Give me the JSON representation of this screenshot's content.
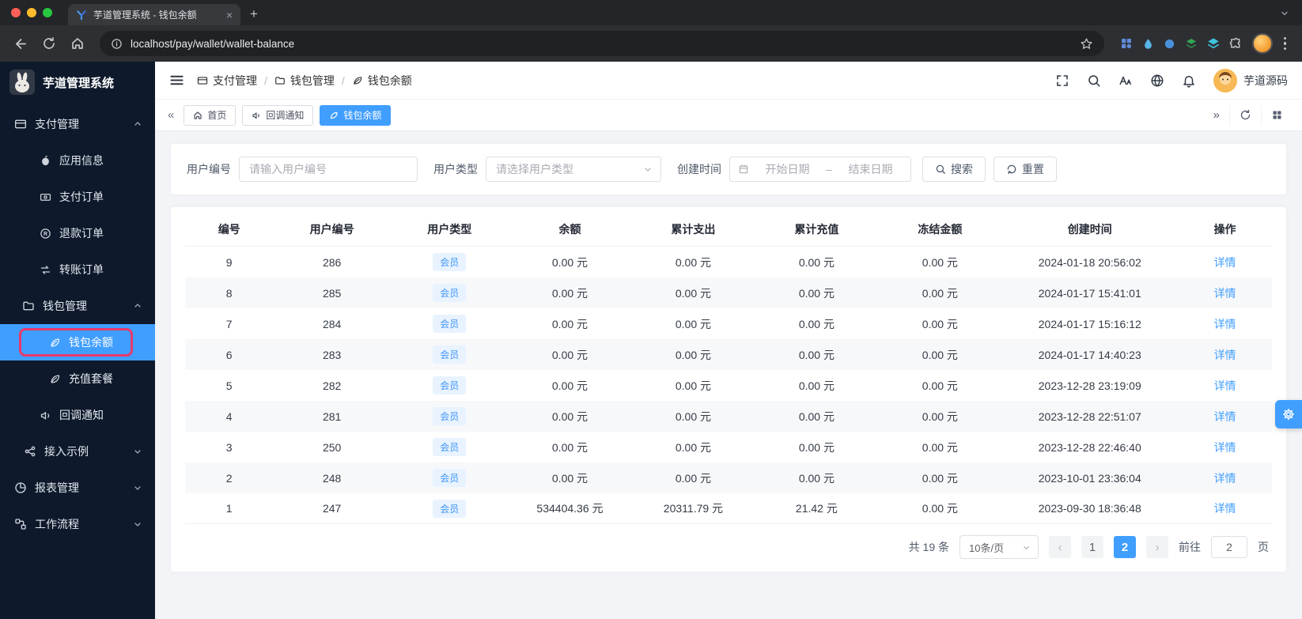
{
  "browser": {
    "tab_title": "芋道管理系统 - 钱包余额",
    "url": "localhost/pay/wallet/wallet-balance"
  },
  "glyphs": {
    "close_tab": "×",
    "new_tab": "+",
    "collapse_left": "«",
    "expand_right": "»",
    "page_prev": "‹",
    "page_next": "›"
  },
  "sidebar": {
    "app_title": "芋道管理系统",
    "menu": [
      {
        "label": "支付管理"
      },
      {
        "label": "应用信息"
      },
      {
        "label": "支付订单"
      },
      {
        "label": "退款订单"
      },
      {
        "label": "转账订单"
      },
      {
        "label": "钱包管理"
      },
      {
        "label": "钱包余额"
      },
      {
        "label": "充值套餐"
      },
      {
        "label": "回调通知"
      },
      {
        "label": "接入示例"
      },
      {
        "label": "报表管理"
      },
      {
        "label": "工作流程"
      }
    ]
  },
  "header": {
    "breadcrumb": {
      "sep": "/",
      "items": [
        {
          "label": "支付管理"
        },
        {
          "label": "钱包管理"
        },
        {
          "label": "钱包余额"
        }
      ]
    },
    "username": "芋道源码"
  },
  "tabs": [
    {
      "label": "首页"
    },
    {
      "label": "回调通知"
    },
    {
      "label": "钱包余额"
    }
  ],
  "filter": {
    "user_id_label": "用户编号",
    "user_id_placeholder": "请输入用户编号",
    "user_type_label": "用户类型",
    "user_type_placeholder": "请选择用户类型",
    "create_time_label": "创建时间",
    "date_start": "开始日期",
    "date_separator": "–",
    "date_end": "结束日期",
    "search": "搜索",
    "reset": "重置"
  },
  "table": {
    "columns": [
      "编号",
      "用户编号",
      "用户类型",
      "余额",
      "累计支出",
      "累计充值",
      "冻结金额",
      "创建时间",
      "操作"
    ],
    "rows": [
      {
        "id": "9",
        "user_id": "286",
        "user_type": "会员",
        "balance": "0.00 元",
        "expense": "0.00 元",
        "recharge": "0.00 元",
        "frozen": "0.00 元",
        "created": "2024-01-18 20:56:02",
        "action": "详情"
      },
      {
        "id": "8",
        "user_id": "285",
        "user_type": "会员",
        "balance": "0.00 元",
        "expense": "0.00 元",
        "recharge": "0.00 元",
        "frozen": "0.00 元",
        "created": "2024-01-17 15:41:01",
        "action": "详情"
      },
      {
        "id": "7",
        "user_id": "284",
        "user_type": "会员",
        "balance": "0.00 元",
        "expense": "0.00 元",
        "recharge": "0.00 元",
        "frozen": "0.00 元",
        "created": "2024-01-17 15:16:12",
        "action": "详情"
      },
      {
        "id": "6",
        "user_id": "283",
        "user_type": "会员",
        "balance": "0.00 元",
        "expense": "0.00 元",
        "recharge": "0.00 元",
        "frozen": "0.00 元",
        "created": "2024-01-17 14:40:23",
        "action": "详情"
      },
      {
        "id": "5",
        "user_id": "282",
        "user_type": "会员",
        "balance": "0.00 元",
        "expense": "0.00 元",
        "recharge": "0.00 元",
        "frozen": "0.00 元",
        "created": "2023-12-28 23:19:09",
        "action": "详情"
      },
      {
        "id": "4",
        "user_id": "281",
        "user_type": "会员",
        "balance": "0.00 元",
        "expense": "0.00 元",
        "recharge": "0.00 元",
        "frozen": "0.00 元",
        "created": "2023-12-28 22:51:07",
        "action": "详情"
      },
      {
        "id": "3",
        "user_id": "250",
        "user_type": "会员",
        "balance": "0.00 元",
        "expense": "0.00 元",
        "recharge": "0.00 元",
        "frozen": "0.00 元",
        "created": "2023-12-28 22:46:40",
        "action": "详情"
      },
      {
        "id": "2",
        "user_id": "248",
        "user_type": "会员",
        "balance": "0.00 元",
        "expense": "0.00 元",
        "recharge": "0.00 元",
        "frozen": "0.00 元",
        "created": "2023-10-01 23:36:04",
        "action": "详情"
      },
      {
        "id": "1",
        "user_id": "247",
        "user_type": "会员",
        "balance": "534404.36 元",
        "expense": "20311.79 元",
        "recharge": "21.42 元",
        "frozen": "0.00 元",
        "created": "2023-09-30 18:36:48",
        "action": "详情"
      }
    ]
  },
  "pagination": {
    "total": "共 19 条",
    "page_size": "10条/页",
    "pages": [
      "1",
      "2"
    ],
    "active_page": "2",
    "goto_label": "前往",
    "goto_value": "2",
    "page_unit": "页"
  },
  "colors": {
    "accent": "#409eff",
    "sidebar_bg": "#0e1a2b",
    "annotation_border": "#e8386d",
    "badge_bg": "#e8f3ff",
    "badge_text": "#4196f7"
  }
}
